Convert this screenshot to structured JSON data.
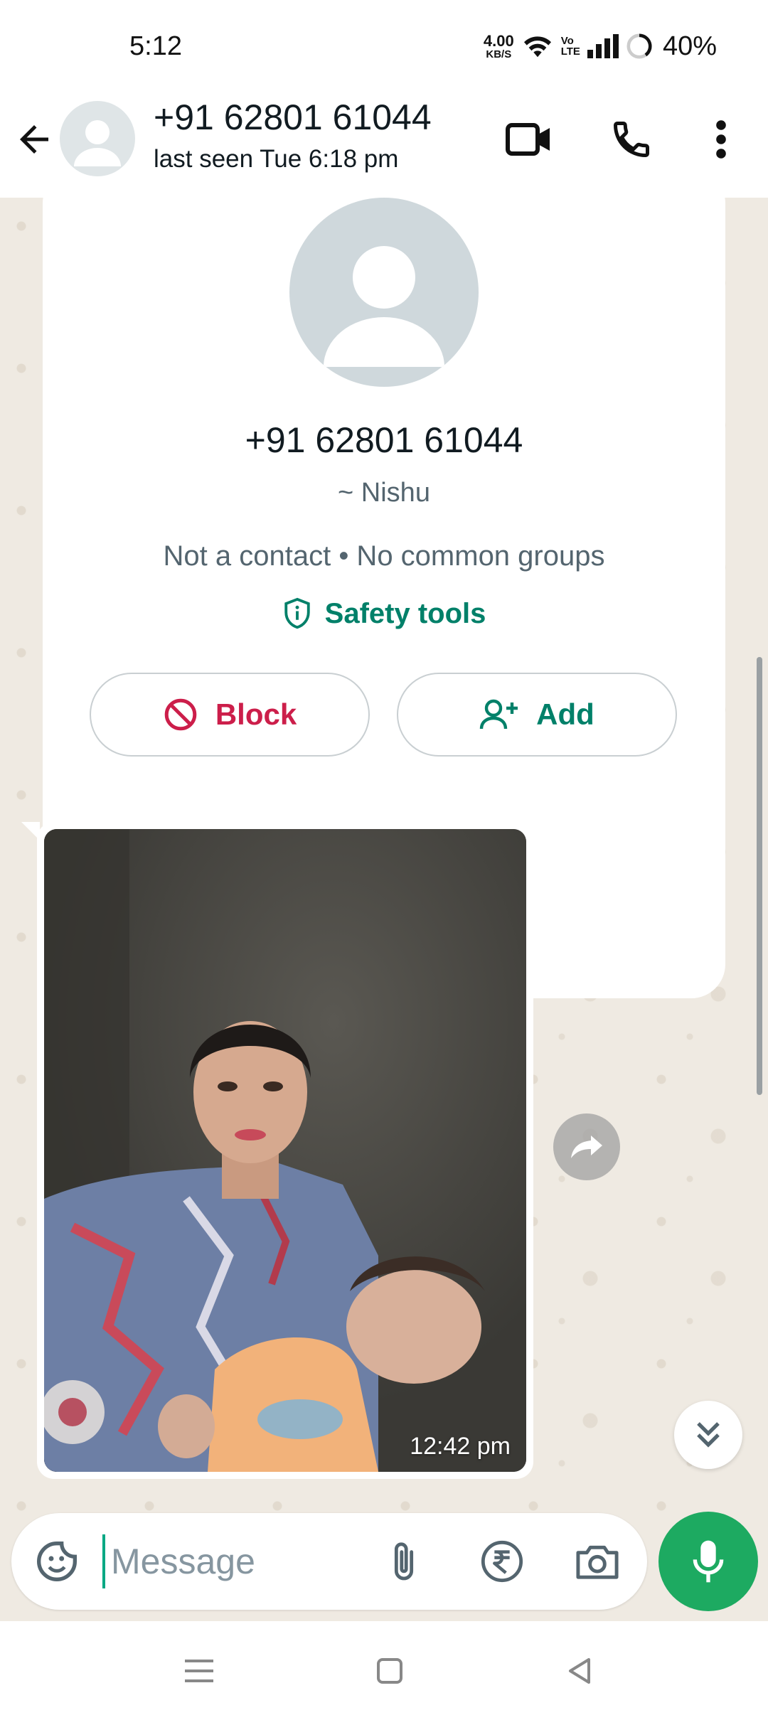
{
  "status_bar": {
    "time": "5:12",
    "net_speed_value": "4.00",
    "net_speed_unit": "KB/S",
    "volte_top": "Vo",
    "volte_bottom": "LTE",
    "battery": "40%"
  },
  "header": {
    "title": "+91 62801 61044",
    "subtitle": "last seen Tue 6:18 pm",
    "icons": [
      "back-arrow-icon",
      "video-call-icon",
      "voice-call-icon",
      "more-vert-icon"
    ]
  },
  "contact_card": {
    "phone": "+91 62801 61044",
    "name": "~ Nishu",
    "meta": "Not a contact • No common groups",
    "safety_label": "Safety tools",
    "block_label": "Block",
    "add_label": "Add"
  },
  "message": {
    "time": "12:42 pm"
  },
  "composer": {
    "placeholder": "Message"
  },
  "colors": {
    "accent_green": "#008069",
    "mic_green": "#1daa61",
    "block_red": "#cc1e4a",
    "chat_bg": "#efeae2"
  }
}
